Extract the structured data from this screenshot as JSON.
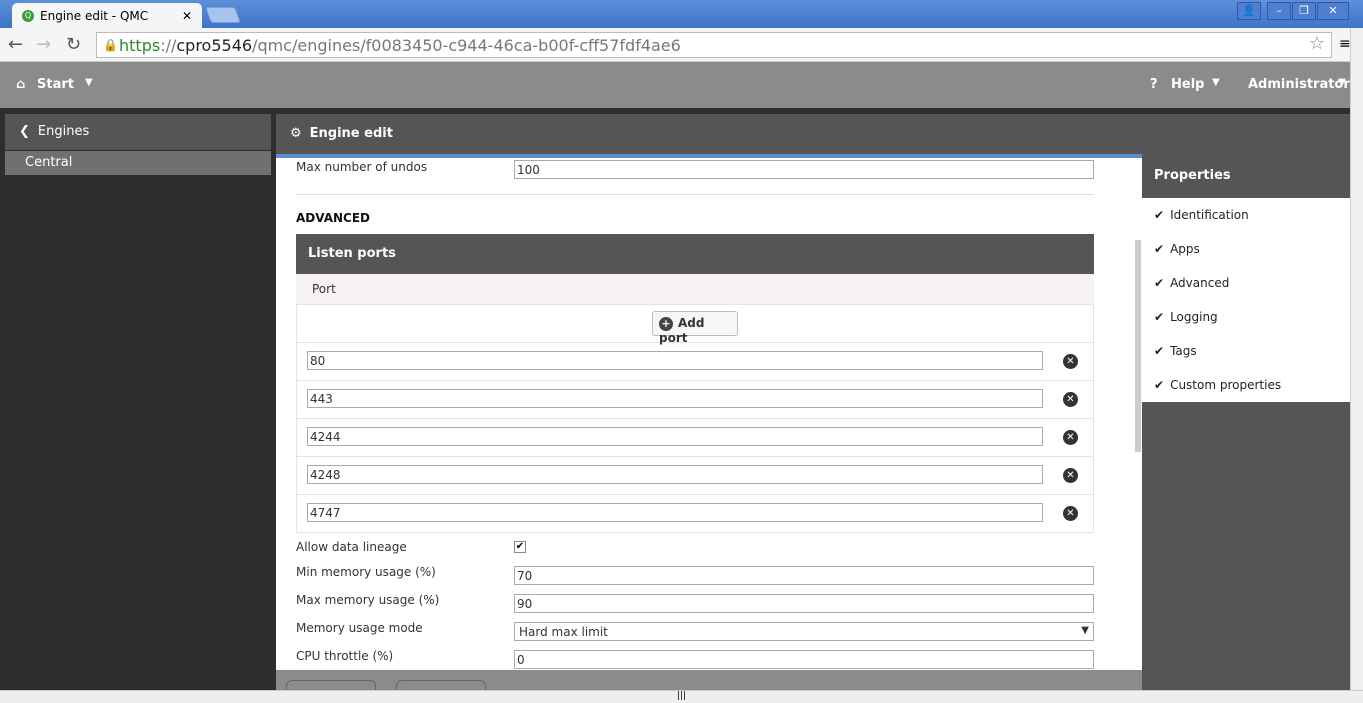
{
  "browser": {
    "tab_title": "Engine edit - QMC",
    "url_scheme": "https",
    "url_sep": "://",
    "url_host": "cpro5546",
    "url_path": "/qmc/engines/f0083450-c944-46ca-b00f-cff57fdf4ae6"
  },
  "header": {
    "start": "Start",
    "help": "Help",
    "user": "Administrator"
  },
  "sidebar": {
    "back": "Engines",
    "item": "Central"
  },
  "page": {
    "title": "Engine edit"
  },
  "form": {
    "undos_label": "Max number of undos",
    "undos_value": "100",
    "section": "ADVANCED",
    "listen_ports": "Listen ports",
    "port_col": "Port",
    "add_port": "Add port",
    "ports": [
      "80",
      "443",
      "4244",
      "4248",
      "4747"
    ],
    "lineage_label": "Allow data lineage",
    "lineage_checked": true,
    "min_mem_label": "Min memory usage (%)",
    "min_mem_value": "70",
    "max_mem_label": "Max memory usage (%)",
    "max_mem_value": "90",
    "mode_label": "Memory usage mode",
    "mode_value": "Hard max limit",
    "cpu_label": "CPU throttle (%)",
    "cpu_value": "0"
  },
  "properties": {
    "title": "Properties",
    "items": [
      "Identification",
      "Apps",
      "Advanced",
      "Logging",
      "Tags",
      "Custom properties"
    ]
  }
}
